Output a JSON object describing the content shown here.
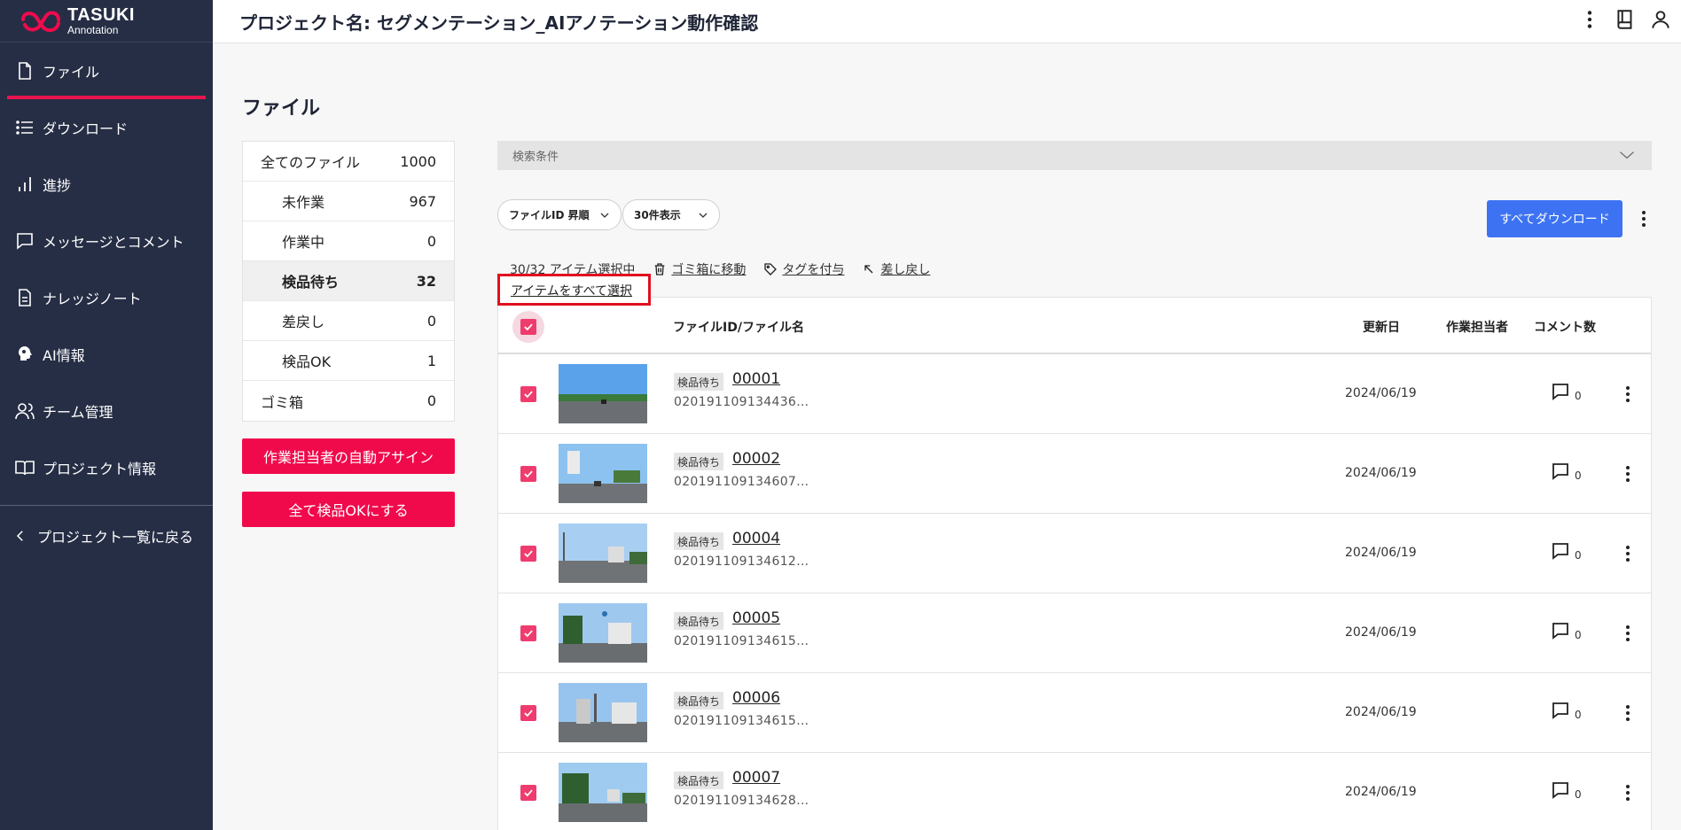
{
  "brand": {
    "name": "TASUKI",
    "sub": "Annotation"
  },
  "sidebar": {
    "items": [
      {
        "label": "ファイル",
        "icon": "file-icon"
      },
      {
        "label": "ダウンロード",
        "icon": "list-icon"
      },
      {
        "label": "進捗",
        "icon": "bar-chart-icon"
      },
      {
        "label": "メッセージとコメント",
        "icon": "chat-icon"
      },
      {
        "label": "ナレッジノート",
        "icon": "document-icon"
      },
      {
        "label": "AI情報",
        "icon": "ai-head-icon"
      },
      {
        "label": "チーム管理",
        "icon": "team-icon"
      },
      {
        "label": "プロジェクト情報",
        "icon": "book-icon"
      }
    ],
    "back_label": "プロジェクト一覧に戻る"
  },
  "header": {
    "title": "プロジェクト名: セグメンテーション_AIアノテーション動作確認"
  },
  "page": {
    "title": "ファイル"
  },
  "status_filter": {
    "rows": [
      {
        "label": "全てのファイル",
        "count": "1000"
      },
      {
        "label": "未作業",
        "count": "967"
      },
      {
        "label": "作業中",
        "count": "0"
      },
      {
        "label": "検品待ち",
        "count": "32"
      },
      {
        "label": "差戻し",
        "count": "0"
      },
      {
        "label": "検品OK",
        "count": "1"
      },
      {
        "label": "ゴミ箱",
        "count": "0"
      }
    ],
    "selected": "検品待ち"
  },
  "actions": {
    "auto_assign": "作業担当者の自動アサイン",
    "all_ok": "全て検品OKにする"
  },
  "search": {
    "label": "検索条件"
  },
  "controls": {
    "sort": "ファイルID 昇順",
    "page_size": "30件表示",
    "download_all": "すべてダウンロード"
  },
  "selection": {
    "count": "30/32 アイテム選択中",
    "trash": "ゴミ箱に移動",
    "tag": "タグを付与",
    "revert": "差し戻し",
    "select_all": "アイテムをすべて選択"
  },
  "table": {
    "headers": {
      "file": "ファイルID/ファイル名",
      "updated": "更新日",
      "assignee": "作業担当者",
      "comments": "コメント数"
    },
    "rows": [
      {
        "status": "検品待ち",
        "id": "00001",
        "name": "020191109134436…",
        "date": "2024/06/19",
        "comments": "0"
      },
      {
        "status": "検品待ち",
        "id": "00002",
        "name": "020191109134607…",
        "date": "2024/06/19",
        "comments": "0"
      },
      {
        "status": "検品待ち",
        "id": "00004",
        "name": "020191109134612…",
        "date": "2024/06/19",
        "comments": "0"
      },
      {
        "status": "検品待ち",
        "id": "00005",
        "name": "020191109134615…",
        "date": "2024/06/19",
        "comments": "0"
      },
      {
        "status": "検品待ち",
        "id": "00006",
        "name": "020191109134615…",
        "date": "2024/06/19",
        "comments": "0"
      },
      {
        "status": "検品待ち",
        "id": "00007",
        "name": "020191109134628…",
        "date": "2024/06/19",
        "comments": "0"
      }
    ]
  },
  "colors": {
    "sidebar": "#262e45",
    "accent": "#f00a4c",
    "primary_button": "#3d73f2",
    "checkbox": "#ef3c6e"
  }
}
